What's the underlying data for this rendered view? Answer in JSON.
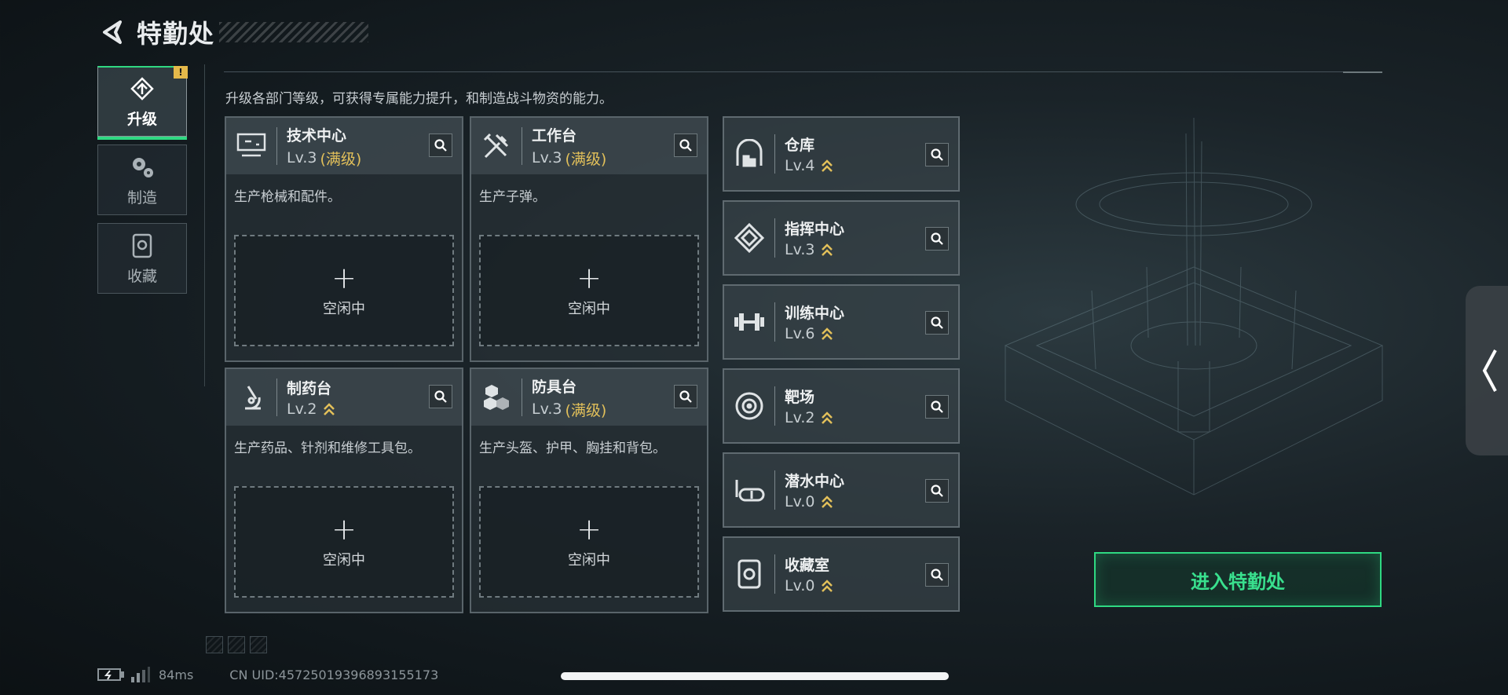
{
  "header": {
    "title": "特勤处"
  },
  "tabs": [
    {
      "label": "升级",
      "icon": "upgrade-icon",
      "active": true,
      "badge": "!"
    },
    {
      "label": "制造",
      "icon": "gears-icon",
      "active": false
    },
    {
      "label": "收藏",
      "icon": "collection-icon",
      "active": false
    }
  ],
  "description": "升级各部门等级，可获得专属能力提升，和制造战斗物资的能力。",
  "workshops": [
    {
      "name": "技术中心",
      "level": "Lv.3",
      "maxed": "(满级)",
      "desc": "生产枪械和配件。",
      "slot_plus": "+",
      "slot_status": "空闲中",
      "icon": "computer-icon"
    },
    {
      "name": "工作台",
      "level": "Lv.3",
      "maxed": "(满级)",
      "desc": "生产子弹。",
      "slot_plus": "+",
      "slot_status": "空闲中",
      "icon": "tools-icon"
    },
    {
      "name": "制药台",
      "level": "Lv.2",
      "maxed": "",
      "desc": "生产药品、针剂和维修工具包。",
      "slot_plus": "+",
      "slot_status": "空闲中",
      "icon": "microscope-icon"
    },
    {
      "name": "防具台",
      "level": "Lv.3",
      "maxed": "(满级)",
      "desc": "生产头盔、护甲、胸挂和背包。",
      "slot_plus": "+",
      "slot_status": "空闲中",
      "icon": "cubes-icon"
    }
  ],
  "facilities": [
    {
      "name": "仓库",
      "level": "Lv.4",
      "icon": "warehouse-icon"
    },
    {
      "name": "指挥中心",
      "level": "Lv.3",
      "icon": "command-icon"
    },
    {
      "name": "训练中心",
      "level": "Lv.6",
      "icon": "dumbbell-icon"
    },
    {
      "name": "靶场",
      "level": "Lv.2",
      "icon": "target-icon"
    },
    {
      "name": "潜水中心",
      "level": "Lv.0",
      "icon": "diving-mask-icon"
    },
    {
      "name": "收藏室",
      "level": "Lv.0",
      "icon": "collection-icon"
    }
  ],
  "enter_button": "进入特勤处",
  "footer": {
    "ping": "84ms",
    "uid": "CN UID:4572501939689315517​3"
  },
  "colors": {
    "accent": "#2fd982",
    "gold": "#e2c05a",
    "upgrade_chevron": "#e2c05a"
  }
}
